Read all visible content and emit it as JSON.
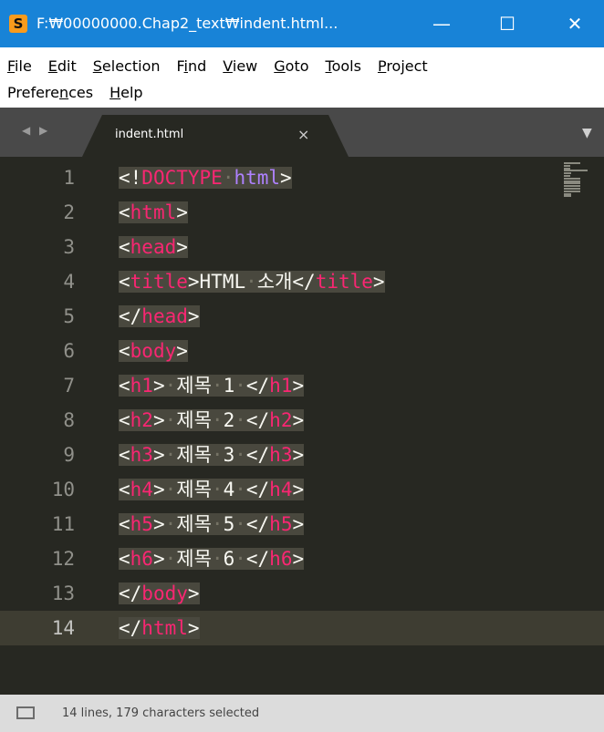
{
  "window": {
    "title": "F:₩00000000.Chap2_text₩indent.html...",
    "app_icon": "S",
    "minimize_glyph": "—",
    "maximize_glyph": "☐",
    "close_glyph": "✕"
  },
  "menu": {
    "row1": [
      {
        "u": "F",
        "rest": "ile"
      },
      {
        "u": "E",
        "rest": "dit"
      },
      {
        "u": "S",
        "rest": "election"
      },
      {
        "pre": "F",
        "u": "i",
        "rest": "nd"
      },
      {
        "u": "V",
        "rest": "iew"
      },
      {
        "u": "G",
        "rest": "oto"
      },
      {
        "u": "T",
        "rest": "ools"
      },
      {
        "u": "P",
        "rest": "roject"
      }
    ],
    "row2": [
      {
        "pre": "Prefere",
        "u": "n",
        "rest": "ces"
      },
      {
        "u": "H",
        "rest": "elp"
      }
    ]
  },
  "tabs": {
    "nav_arrows": "◀ ▶",
    "active_tab": "indent.html",
    "close_glyph": "×",
    "dropdown_glyph": "▼"
  },
  "editor": {
    "line_numbers": [
      "1",
      "2",
      "3",
      "4",
      "5",
      "6",
      "7",
      "8",
      "9",
      "10",
      "11",
      "12",
      "13",
      "14"
    ],
    "active_line": 14,
    "lines": [
      [
        {
          "c": "punct",
          "t": "<!"
        },
        {
          "c": "tag",
          "t": "DOCTYPE"
        },
        {
          "c": "dot",
          "t": "·"
        },
        {
          "c": "doctype",
          "t": "html"
        },
        {
          "c": "punct",
          "t": ">"
        }
      ],
      [
        {
          "c": "punct",
          "t": "<"
        },
        {
          "c": "tag",
          "t": "html"
        },
        {
          "c": "punct",
          "t": ">"
        }
      ],
      [
        {
          "c": "punct",
          "t": "<"
        },
        {
          "c": "tag",
          "t": "head"
        },
        {
          "c": "punct",
          "t": ">"
        }
      ],
      [
        {
          "c": "punct",
          "t": "<"
        },
        {
          "c": "tag",
          "t": "title"
        },
        {
          "c": "punct",
          "t": ">"
        },
        {
          "c": "txt",
          "t": "HTML"
        },
        {
          "c": "dot",
          "t": "·"
        },
        {
          "c": "txt",
          "t": "소개"
        },
        {
          "c": "punct",
          "t": "</"
        },
        {
          "c": "tag",
          "t": "title"
        },
        {
          "c": "punct",
          "t": ">"
        }
      ],
      [
        {
          "c": "punct",
          "t": "</"
        },
        {
          "c": "tag",
          "t": "head"
        },
        {
          "c": "punct",
          "t": ">"
        }
      ],
      [
        {
          "c": "punct",
          "t": "<"
        },
        {
          "c": "tag",
          "t": "body"
        },
        {
          "c": "punct",
          "t": ">"
        }
      ],
      [
        {
          "c": "punct",
          "t": "<"
        },
        {
          "c": "tag",
          "t": "h1"
        },
        {
          "c": "punct",
          "t": ">"
        },
        {
          "c": "dot",
          "t": "·"
        },
        {
          "c": "txt",
          "t": "제목"
        },
        {
          "c": "dot",
          "t": "·"
        },
        {
          "c": "txt",
          "t": "1"
        },
        {
          "c": "dot",
          "t": "·"
        },
        {
          "c": "punct",
          "t": "</"
        },
        {
          "c": "tag",
          "t": "h1"
        },
        {
          "c": "punct",
          "t": ">"
        }
      ],
      [
        {
          "c": "punct",
          "t": "<"
        },
        {
          "c": "tag",
          "t": "h2"
        },
        {
          "c": "punct",
          "t": ">"
        },
        {
          "c": "dot",
          "t": "·"
        },
        {
          "c": "txt",
          "t": "제목"
        },
        {
          "c": "dot",
          "t": "·"
        },
        {
          "c": "txt",
          "t": "2"
        },
        {
          "c": "dot",
          "t": "·"
        },
        {
          "c": "punct",
          "t": "</"
        },
        {
          "c": "tag",
          "t": "h2"
        },
        {
          "c": "punct",
          "t": ">"
        }
      ],
      [
        {
          "c": "punct",
          "t": "<"
        },
        {
          "c": "tag",
          "t": "h3"
        },
        {
          "c": "punct",
          "t": ">"
        },
        {
          "c": "dot",
          "t": "·"
        },
        {
          "c": "txt",
          "t": "제목"
        },
        {
          "c": "dot",
          "t": "·"
        },
        {
          "c": "txt",
          "t": "3"
        },
        {
          "c": "dot",
          "t": "·"
        },
        {
          "c": "punct",
          "t": "</"
        },
        {
          "c": "tag",
          "t": "h3"
        },
        {
          "c": "punct",
          "t": ">"
        }
      ],
      [
        {
          "c": "punct",
          "t": "<"
        },
        {
          "c": "tag",
          "t": "h4"
        },
        {
          "c": "punct",
          "t": ">"
        },
        {
          "c": "dot",
          "t": "·"
        },
        {
          "c": "txt",
          "t": "제목"
        },
        {
          "c": "dot",
          "t": "·"
        },
        {
          "c": "txt",
          "t": "4"
        },
        {
          "c": "dot",
          "t": "·"
        },
        {
          "c": "punct",
          "t": "</"
        },
        {
          "c": "tag",
          "t": "h4"
        },
        {
          "c": "punct",
          "t": ">"
        }
      ],
      [
        {
          "c": "punct",
          "t": "<"
        },
        {
          "c": "tag",
          "t": "h5"
        },
        {
          "c": "punct",
          "t": ">"
        },
        {
          "c": "dot",
          "t": "·"
        },
        {
          "c": "txt",
          "t": "제목"
        },
        {
          "c": "dot",
          "t": "·"
        },
        {
          "c": "txt",
          "t": "5"
        },
        {
          "c": "dot",
          "t": "·"
        },
        {
          "c": "punct",
          "t": "</"
        },
        {
          "c": "tag",
          "t": "h5"
        },
        {
          "c": "punct",
          "t": ">"
        }
      ],
      [
        {
          "c": "punct",
          "t": "<"
        },
        {
          "c": "tag",
          "t": "h6"
        },
        {
          "c": "punct",
          "t": ">"
        },
        {
          "c": "dot",
          "t": "·"
        },
        {
          "c": "txt",
          "t": "제목"
        },
        {
          "c": "dot",
          "t": "·"
        },
        {
          "c": "txt",
          "t": "6"
        },
        {
          "c": "dot",
          "t": "·"
        },
        {
          "c": "punct",
          "t": "</"
        },
        {
          "c": "tag",
          "t": "h6"
        },
        {
          "c": "punct",
          "t": ">"
        }
      ],
      [
        {
          "c": "punct",
          "t": "</"
        },
        {
          "c": "tag",
          "t": "body"
        },
        {
          "c": "punct",
          "t": ">"
        }
      ],
      [
        {
          "c": "punct",
          "t": "</"
        },
        {
          "c": "tag",
          "t": "html"
        },
        {
          "c": "punct",
          "t": ">"
        }
      ]
    ]
  },
  "status": {
    "text": "14 lines, 179 characters selected"
  },
  "colors": {
    "titlebar": "#1883d7",
    "editor_bg": "#272822",
    "selection": "#49483e",
    "tag": "#f92672",
    "doctype": "#ae81ff",
    "text": "#f8f8f2"
  }
}
